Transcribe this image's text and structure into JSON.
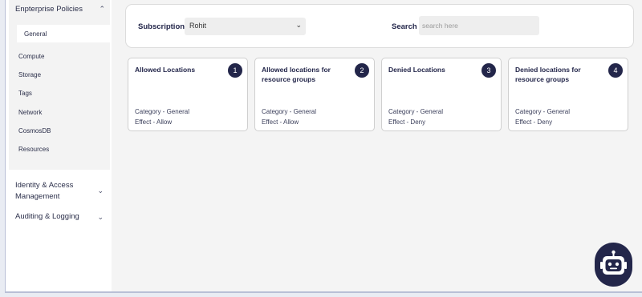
{
  "sidebar": {
    "section_title": "Enpterprise Policies",
    "active_item": "General",
    "items": [
      "Compute",
      "Storage",
      "Tags",
      "Network",
      "CosmosDB",
      "Resources"
    ],
    "groups": [
      {
        "label": "Identity & Access Management"
      },
      {
        "label": "Auditing & Logging"
      }
    ]
  },
  "filters": {
    "subscription_label": "Subscription",
    "subscription_value": "Rohit",
    "search_label": "Search",
    "search_placeholder": "search here"
  },
  "cards": [
    {
      "title": "Allowed Locations",
      "number": "1",
      "category": "Category - General",
      "effect": "Effect - Allow"
    },
    {
      "title": "Allowed locations for resource groups",
      "number": "2",
      "category": "Category - General",
      "effect": "Effect - Allow"
    },
    {
      "title": "Denied Locations",
      "number": "3",
      "category": "Category - General",
      "effect": "Effect - Deny"
    },
    {
      "title": "Denied locations for resource groups",
      "number": "4",
      "category": "Category - General",
      "effect": "Effect - Deny"
    }
  ],
  "icons": {
    "expand": "chevron-up-icon",
    "collapse": "chevron-down-icon",
    "dropdown": "caret-down-icon",
    "assistant": "robot-icon"
  },
  "colors": {
    "accent": "#23264a",
    "panel": "#ffffff",
    "background": "#f4f4f4"
  }
}
